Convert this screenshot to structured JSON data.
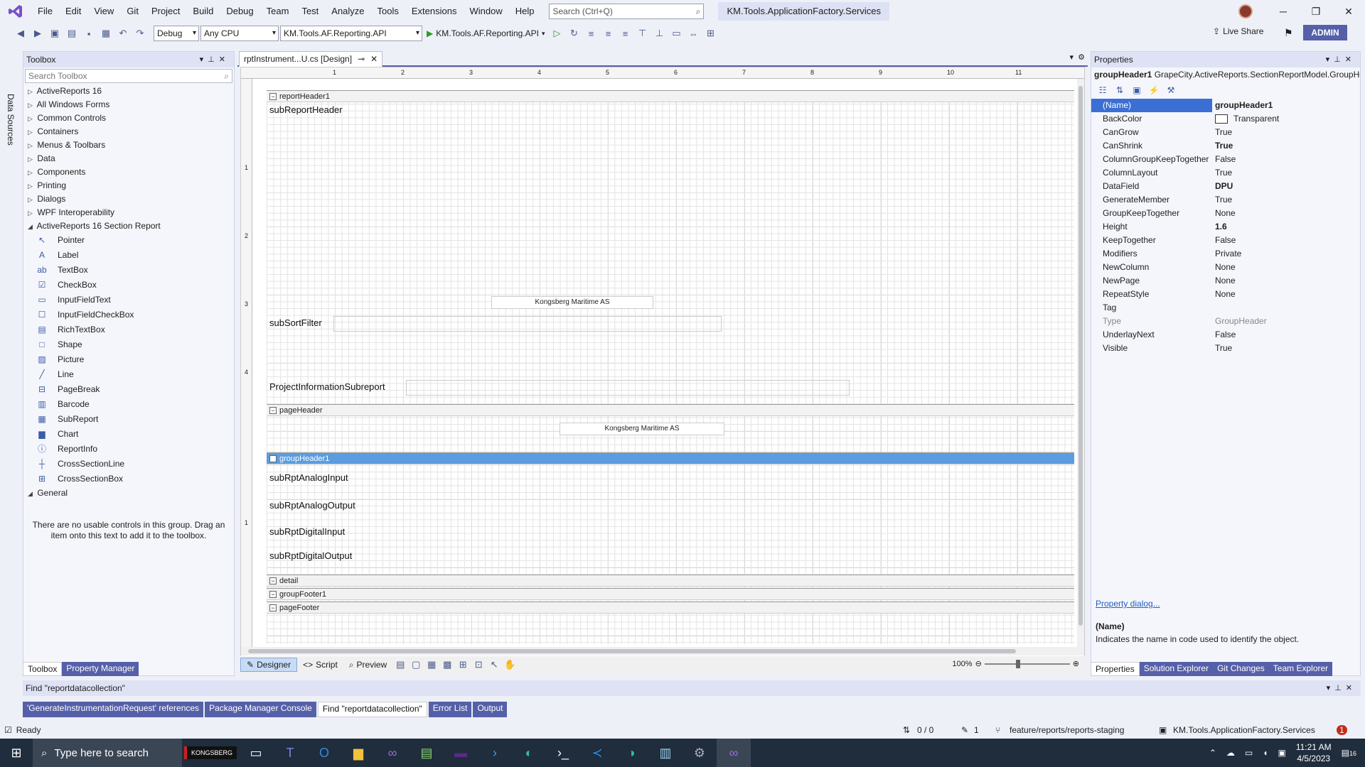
{
  "menu": [
    "File",
    "Edit",
    "View",
    "Git",
    "Project",
    "Build",
    "Debug",
    "Team",
    "Test",
    "Analyze",
    "Tools",
    "Extensions",
    "Window",
    "Help"
  ],
  "search": {
    "placeholder": "Search (Ctrl+Q)"
  },
  "solution_title": "KM.Tools.ApplicationFactory.Services",
  "toolbar": {
    "config": "Debug",
    "platform": "Any CPU",
    "startup": "KM.Tools.AF.Reporting.API",
    "run_label": "KM.Tools.AF.Reporting.API",
    "live_share": "Live Share",
    "admin": "ADMIN"
  },
  "left_rail": {
    "data_sources": "Data Sources"
  },
  "toolbox": {
    "title": "Toolbox",
    "search_placeholder": "Search Toolbox",
    "categories": [
      "ActiveReports 16",
      "All Windows Forms",
      "Common Controls",
      "Containers",
      "Menus & Toolbars",
      "Data",
      "Components",
      "Printing",
      "Dialogs",
      "WPF Interoperability"
    ],
    "expanded_category": "ActiveReports 16 Section Report",
    "items": [
      {
        "label": "Pointer",
        "icon": "pointer-icon"
      },
      {
        "label": "Label",
        "icon": "label-icon"
      },
      {
        "label": "TextBox",
        "icon": "textbox-icon"
      },
      {
        "label": "CheckBox",
        "icon": "checkbox-icon"
      },
      {
        "label": "InputFieldText",
        "icon": "inputfieldtext-icon"
      },
      {
        "label": "InputFieldCheckBox",
        "icon": "inputfieldcheckbox-icon"
      },
      {
        "label": "RichTextBox",
        "icon": "richtextbox-icon"
      },
      {
        "label": "Shape",
        "icon": "shape-icon"
      },
      {
        "label": "Picture",
        "icon": "picture-icon"
      },
      {
        "label": "Line",
        "icon": "line-icon"
      },
      {
        "label": "PageBreak",
        "icon": "pagebreak-icon"
      },
      {
        "label": "Barcode",
        "icon": "barcode-icon"
      },
      {
        "label": "SubReport",
        "icon": "subreport-icon"
      },
      {
        "label": "Chart",
        "icon": "chart-icon"
      },
      {
        "label": "ReportInfo",
        "icon": "reportinfo-icon"
      },
      {
        "label": "CrossSectionLine",
        "icon": "crosssectionline-icon"
      },
      {
        "label": "CrossSectionBox",
        "icon": "crosssectionbox-icon"
      }
    ],
    "general": "General",
    "empty_message": "There are no usable controls in this group. Drag an item onto this text to add it to the toolbox.",
    "tabs": [
      "Toolbox",
      "Property Manager"
    ]
  },
  "document": {
    "tab": "rptInstrument...U.cs [Design]",
    "ruler": [
      "1",
      "2",
      "3",
      "4",
      "5",
      "6",
      "7",
      "8",
      "9",
      "10",
      "11"
    ],
    "vruler": [
      "1",
      "2",
      "3",
      "4",
      "1"
    ],
    "sections": {
      "report_header": "reportHeader1",
      "page_header": "pageHeader",
      "group_header": "groupHeader1",
      "detail": "detail",
      "group_footer": "groupFooter1",
      "page_footer": "pageFooter"
    },
    "controls": {
      "subReportHeader": "subReportHeader",
      "company1": "Kongsberg Maritime AS",
      "subSortFilter": "subSortFilter",
      "projectInfo": "ProjectInformationSubreport",
      "company2": "Kongsberg Maritime AS",
      "analogInput": "subRptAnalogInput",
      "analogOutput": "subRptAnalogOutput",
      "digitalInput": "subRptDigitalInput",
      "digitalOutput": "subRptDigitalOutput"
    },
    "bottom_tabs": {
      "designer": "Designer",
      "script": "Script",
      "preview": "Preview"
    },
    "zoom": "100%"
  },
  "properties": {
    "title": "Properties",
    "selected": "groupHeader1",
    "selected_type": "GrapeCity.ActiveReports.SectionReportModel.GroupHeader",
    "rows": [
      {
        "name": "(Name)",
        "value": "groupHeader1",
        "bold": true,
        "sel": true
      },
      {
        "name": "BackColor",
        "value": "Transparent"
      },
      {
        "name": "CanGrow",
        "value": "True"
      },
      {
        "name": "CanShrink",
        "value": "True",
        "bold": true
      },
      {
        "name": "ColumnGroupKeepTogether",
        "value": "False"
      },
      {
        "name": "ColumnLayout",
        "value": "True"
      },
      {
        "name": "DataField",
        "value": "DPU",
        "bold": true
      },
      {
        "name": "GenerateMember",
        "value": "True"
      },
      {
        "name": "GroupKeepTogether",
        "value": "None"
      },
      {
        "name": "Height",
        "value": "1.6",
        "bold": true
      },
      {
        "name": "KeepTogether",
        "value": "False"
      },
      {
        "name": "Modifiers",
        "value": "Private"
      },
      {
        "name": "NewColumn",
        "value": "None"
      },
      {
        "name": "NewPage",
        "value": "None"
      },
      {
        "name": "RepeatStyle",
        "value": "None"
      },
      {
        "name": "Tag",
        "value": ""
      },
      {
        "name": "Type",
        "value": "GroupHeader",
        "gray": true
      },
      {
        "name": "UnderlayNext",
        "value": "False"
      },
      {
        "name": "Visible",
        "value": "True"
      }
    ],
    "dialog_link": "Property dialog...",
    "desc_title": "(Name)",
    "desc_text": "Indicates the name in code used to identify the object.",
    "tabs": [
      "Properties",
      "Solution Explorer",
      "Git Changes",
      "Team Explorer"
    ]
  },
  "find": {
    "title": "Find \"reportdatacollection\""
  },
  "output_tabs": [
    "'GenerateInstrumentationRequest' references",
    "Package Manager Console",
    "Find \"reportdatacollection\"",
    "Error List",
    "Output"
  ],
  "status": {
    "ready": "Ready",
    "updown": "0 / 0",
    "pencil": "1",
    "branch": "feature/reports/reports-staging",
    "repo": "KM.Tools.ApplicationFactory.Services",
    "notif": "1"
  },
  "taskbar": {
    "search": "Type here to search",
    "kongsberg": "KONGSBERG",
    "time": "11:21 AM",
    "date": "4/5/2023",
    "notif": "16"
  }
}
